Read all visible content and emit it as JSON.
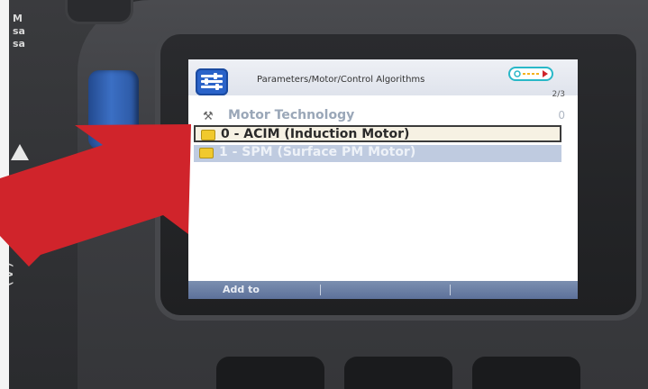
{
  "screen": {
    "breadcrumb": "Parameters/Motor/Control Algorithms",
    "page_indicator": "2/3",
    "section": {
      "title": "Motor Technology",
      "value": "0"
    },
    "options": [
      {
        "label": "0 - ACIM (Induction Motor)",
        "selected": true
      },
      {
        "label": "1 - SPM (Surface PM Motor)",
        "selected": false
      }
    ],
    "softkeys": {
      "left": "Add to",
      "middle": "",
      "right": ""
    }
  },
  "background_print": {
    "top_lines": [
      "M",
      "sa",
      "sa"
    ],
    "side_text": "(A)"
  },
  "colors": {
    "menu_button": "#2a63c9",
    "selected_row_bg": "#f6f1e3",
    "unselected_row_bg": "#bfcbe0",
    "softkey_bar": "#6a7fa5",
    "folder_icon": "#f1c92d",
    "status_icon_border": "#29b8c8",
    "arrow": "#d0242b",
    "blue_key": "#3b6fc4"
  },
  "icons": {
    "menu": "menu-sliders-icon",
    "section": "tools-icon",
    "option": "folder-icon",
    "status": "connection-status-icon"
  }
}
